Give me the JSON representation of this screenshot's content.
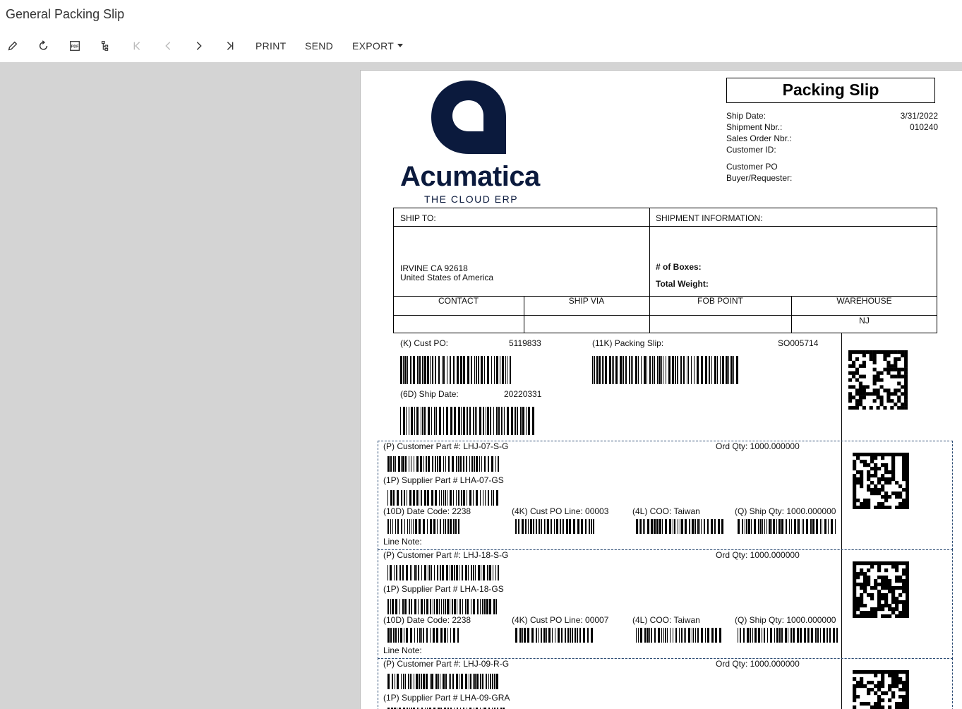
{
  "app": {
    "title": "General Packing Slip"
  },
  "toolbar": {
    "print": "PRINT",
    "send": "SEND",
    "export": "EXPORT",
    "icons": [
      "pencil-icon",
      "refresh-icon",
      "pdf-icon",
      "tree-icon",
      "first-page-icon",
      "prev-page-icon",
      "next-page-icon",
      "last-page-icon"
    ]
  },
  "report": {
    "logo_word": "Acumatica",
    "logo_tag": "THE CLOUD ERP",
    "title": "Packing Slip",
    "ship_date_label": "Ship Date:",
    "ship_date": "3/31/2022",
    "shipment_nbr_label": "Shipment Nbr.:",
    "shipment_nbr": "010240",
    "sales_order_label": "Sales Order Nbr.:",
    "customer_id_label": "Customer ID:",
    "customer_po_label": "Customer PO",
    "buyer_label": "Buyer/Requester:",
    "ship_to_label": "SHIP TO:",
    "ship_info_label": "SHIPMENT INFORMATION:",
    "address_line1": "IRVINE CA 92618",
    "address_line2": "United States of America",
    "boxes_label": "# of Boxes:",
    "weight_label": "Total Weight:",
    "col_contact": "CONTACT",
    "col_ship_via": "SHIP VIA",
    "col_fob": "FOB POINT",
    "col_warehouse": "WAREHOUSE",
    "warehouse_value": "NJ",
    "cust_po_label": "(K) Cust PO:",
    "cust_po_value": "5119833",
    "packing_slip_label": "(11K) Packing Slip:",
    "packing_slip_value": "SO005714",
    "ship_date_code_label": "(6D) Ship Date:",
    "ship_date_code_value": "20220331"
  },
  "lines": [
    {
      "customer_part": "(P) Customer Part #: LHJ-07-S-G",
      "ord_qty": "Ord Qty: 1000.000000",
      "supplier_part": "(1P) Supplier Part # LHA-07-GS",
      "date_code": "(10D) Date Code: 2238",
      "cust_po_line": "(4K) Cust PO Line: 00003",
      "coo": "(4L) COO: Taiwan",
      "ship_qty": "(Q) Ship Qty: 1000.000000",
      "line_note": "Line Note:"
    },
    {
      "customer_part": "(P) Customer Part #: LHJ-18-S-G",
      "ord_qty": "Ord Qty: 1000.000000",
      "supplier_part": "(1P) Supplier Part # LHA-18-GS",
      "date_code": "(10D) Date Code: 2238",
      "cust_po_line": "(4K) Cust PO Line: 00007",
      "coo": "(4L) COO: Taiwan",
      "ship_qty": "(Q) Ship Qty: 1000.000000",
      "line_note": "Line Note:"
    },
    {
      "customer_part": "(P) Customer Part #: LHJ-09-R-G",
      "ord_qty": "Ord Qty: 1000.000000",
      "supplier_part": "(1P) Supplier Part # LHA-09-GRA"
    }
  ]
}
